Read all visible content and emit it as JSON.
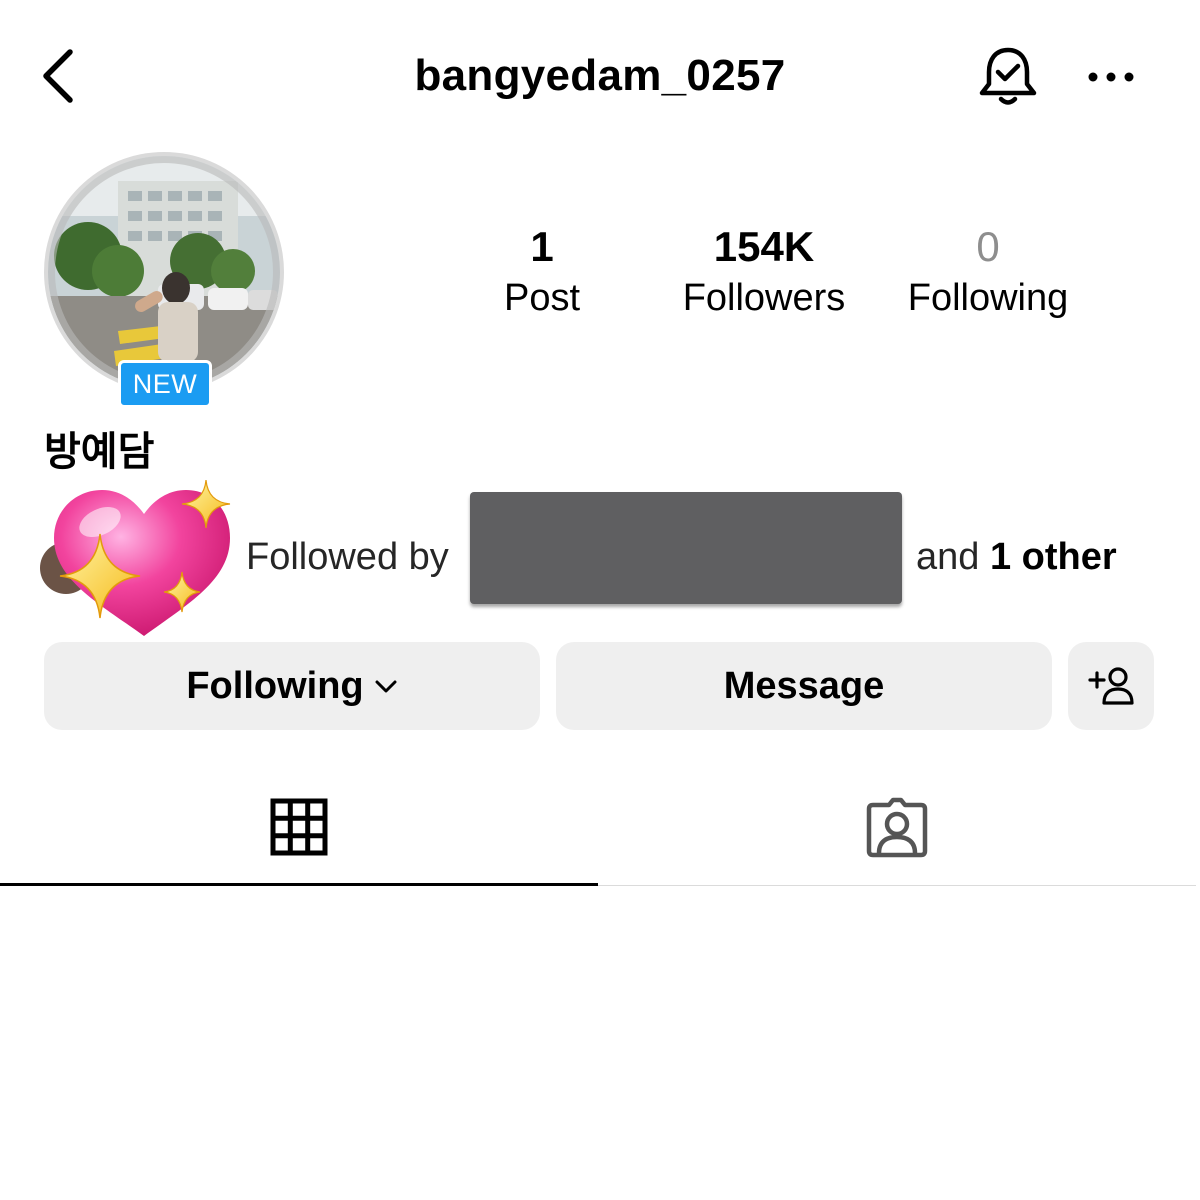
{
  "header": {
    "username": "bangyedam_0257",
    "back_icon": "chevron-left-icon",
    "notification_icon": "bell-check-icon",
    "more_icon": "more-horizontal-icon"
  },
  "profile": {
    "badge": "NEW",
    "display_name": "방예담",
    "badge_color": "#1b9cf2"
  },
  "stats": {
    "posts": {
      "value": "1",
      "label": "Post"
    },
    "followers": {
      "value": "154K",
      "label": "Followers"
    },
    "following": {
      "value": "0",
      "label": "Following"
    }
  },
  "followed_by": {
    "prefix": "Followed by",
    "and_label": "and ",
    "others": "1 other",
    "emoji_icon": "sparkling-heart-icon"
  },
  "actions": {
    "following_label": "Following",
    "message_label": "Message",
    "add_icon": "add-person-icon"
  },
  "tabs": [
    {
      "icon": "grid-icon",
      "active": true
    },
    {
      "icon": "tagged-person-icon",
      "active": false
    }
  ]
}
